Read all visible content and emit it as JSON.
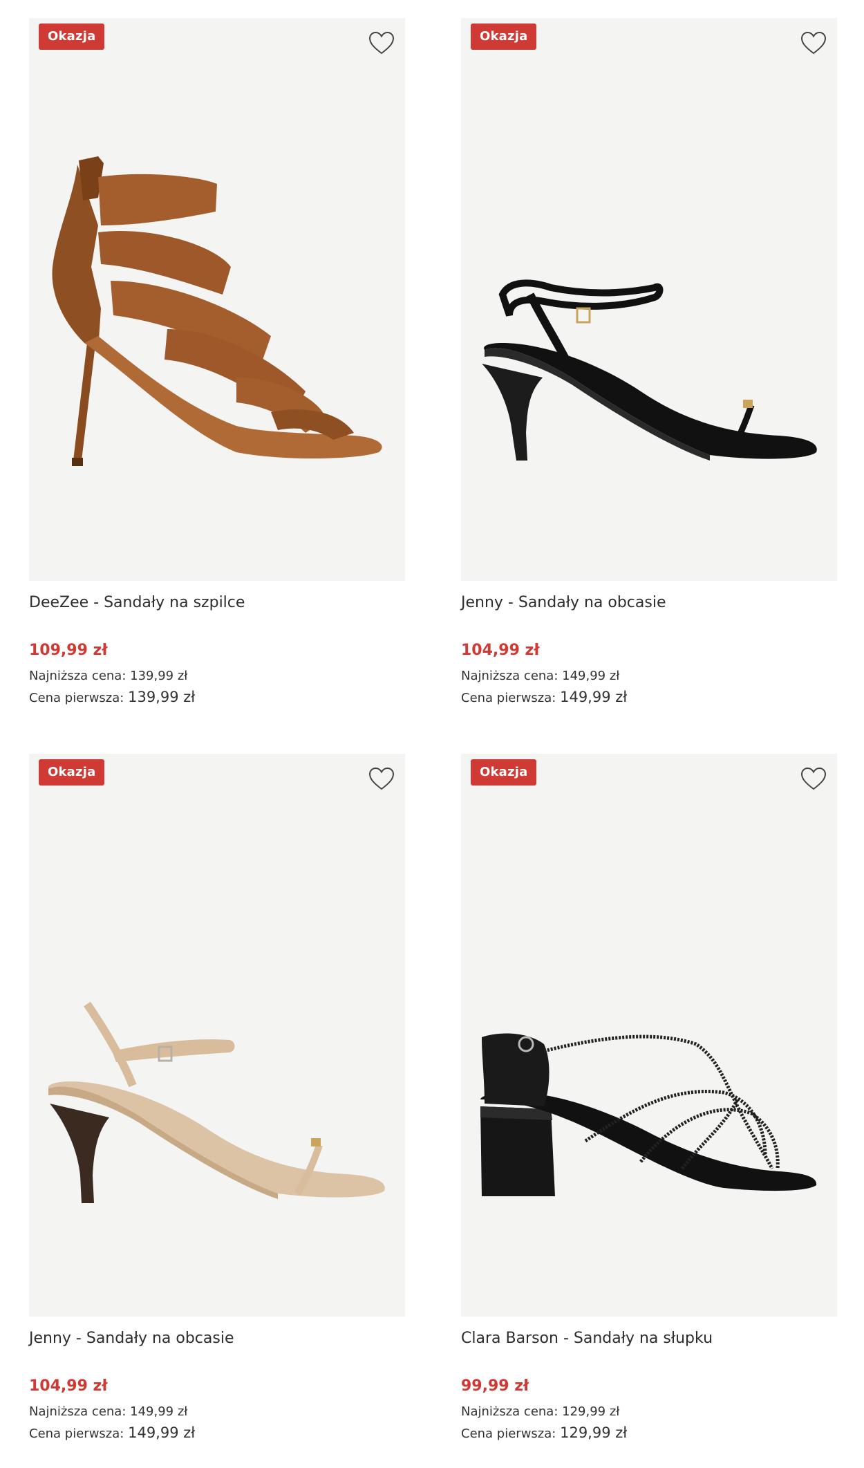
{
  "colors": {
    "badge": "#cf3a34",
    "price": "#cf3a34",
    "image_bg": "#f4f4f3",
    "text": "#2d2d2d"
  },
  "icons": {
    "favorite": "heart-outline-icon"
  },
  "products": [
    {
      "badge": "Okazja",
      "image": "brown suede strappy stiletto sandal",
      "title": "DeeZee - Sandały na szpilce",
      "price": "109,99 zł",
      "lowest_label": "Najniższa cena:",
      "lowest_value": "139,99 zł",
      "first_label": "Cena pierwsza:",
      "first_value": "139,99 zł"
    },
    {
      "badge": "Okazja",
      "image": "black leather heeled sandal",
      "title": "Jenny - Sandały na obcasie",
      "price": "104,99 zł",
      "lowest_label": "Najniższa cena:",
      "lowest_value": "149,99 zł",
      "first_label": "Cena pierwsza:",
      "first_value": "149,99 zł"
    },
    {
      "badge": "Okazja",
      "image": "beige leather heeled sandal",
      "title": "Jenny - Sandały na obcasie",
      "price": "104,99 zł",
      "lowest_label": "Najniższa cena:",
      "lowest_value": "149,99 zł",
      "first_label": "Cena pierwsza:",
      "first_value": "149,99 zł"
    },
    {
      "badge": "Okazja",
      "image": "black block heel strappy sandal",
      "title": "Clara Barson - Sandały na słupku",
      "price": "99,99 zł",
      "lowest_label": "Najniższa cena:",
      "lowest_value": "129,99 zł",
      "first_label": "Cena pierwsza:",
      "first_value": "129,99 zł"
    }
  ]
}
